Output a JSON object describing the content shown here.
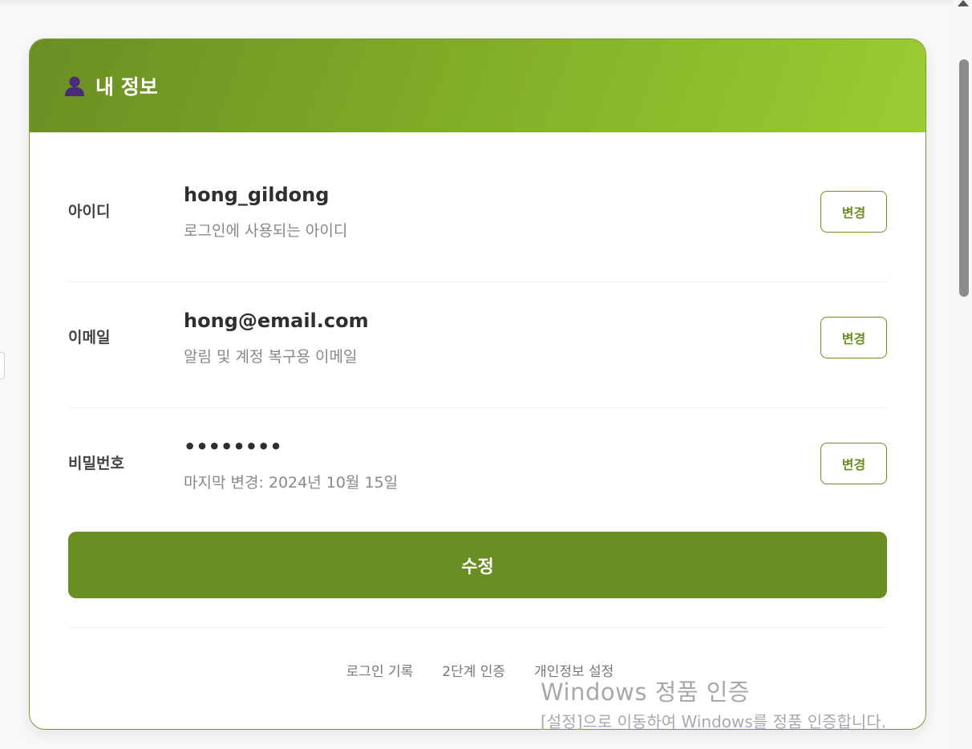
{
  "header": {
    "icon": "user-icon",
    "title": "내 정보"
  },
  "fields": [
    {
      "label": "아이디",
      "value": "hong_gildong",
      "description": "로그인에 사용되는 아이디",
      "button": "변경"
    },
    {
      "label": "이메일",
      "value": "hong@email.com",
      "description": "알림 및 계정 복구용 이메일",
      "button": "변경"
    },
    {
      "label": "비밀번호",
      "value": "••••••••",
      "description": "마지막 변경: 2024년 10월 15일",
      "button": "변경"
    }
  ],
  "submit_label": "수정",
  "footer_links": [
    "로그인 기록",
    "2단계 인증",
    "개인정보 설정"
  ],
  "watermark": {
    "title": "Windows 정품 인증",
    "description": "[설정]으로 이동하여 Windows를 정품 인증합니다."
  },
  "colors": {
    "accent": "#6b8e23",
    "header_gradient_end": "#9acd32"
  }
}
